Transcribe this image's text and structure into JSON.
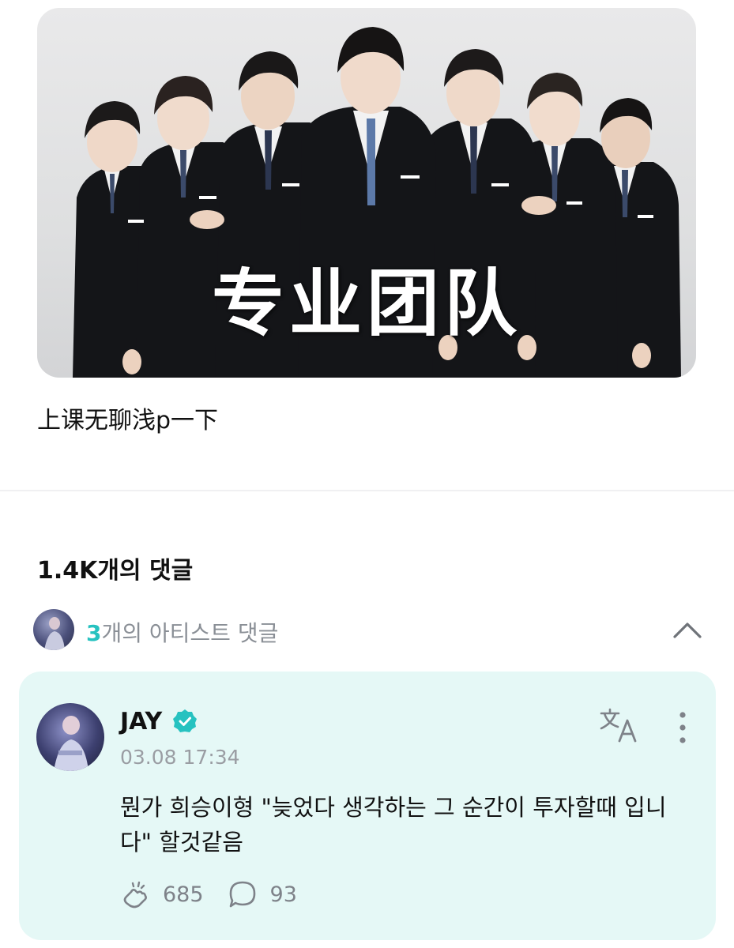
{
  "post": {
    "image_overlay_text": "专业团队",
    "caption": "上课无聊浅p一下"
  },
  "comments": {
    "count_label": "1.4K개의 댓글",
    "artist_summary": {
      "count": "3",
      "label": "개의 아티스트 댓글"
    }
  },
  "comment": {
    "author": "JAY",
    "time": "03.08 17:34",
    "text": "뭔가 희승이형 \"늦었다 생각하는 그 순간이 투자할때 입니다\" 할것같음",
    "likes": "685",
    "replies": "93"
  },
  "colors": {
    "accent": "#26c2c0",
    "card_bg": "#e5f8f6",
    "muted_text": "#8a8f96"
  },
  "icons": [
    "collapse-chevron-up-icon",
    "verified-badge-icon",
    "translate-icon",
    "more-vertical-icon",
    "cheer-icon",
    "reply-bubble-icon"
  ]
}
